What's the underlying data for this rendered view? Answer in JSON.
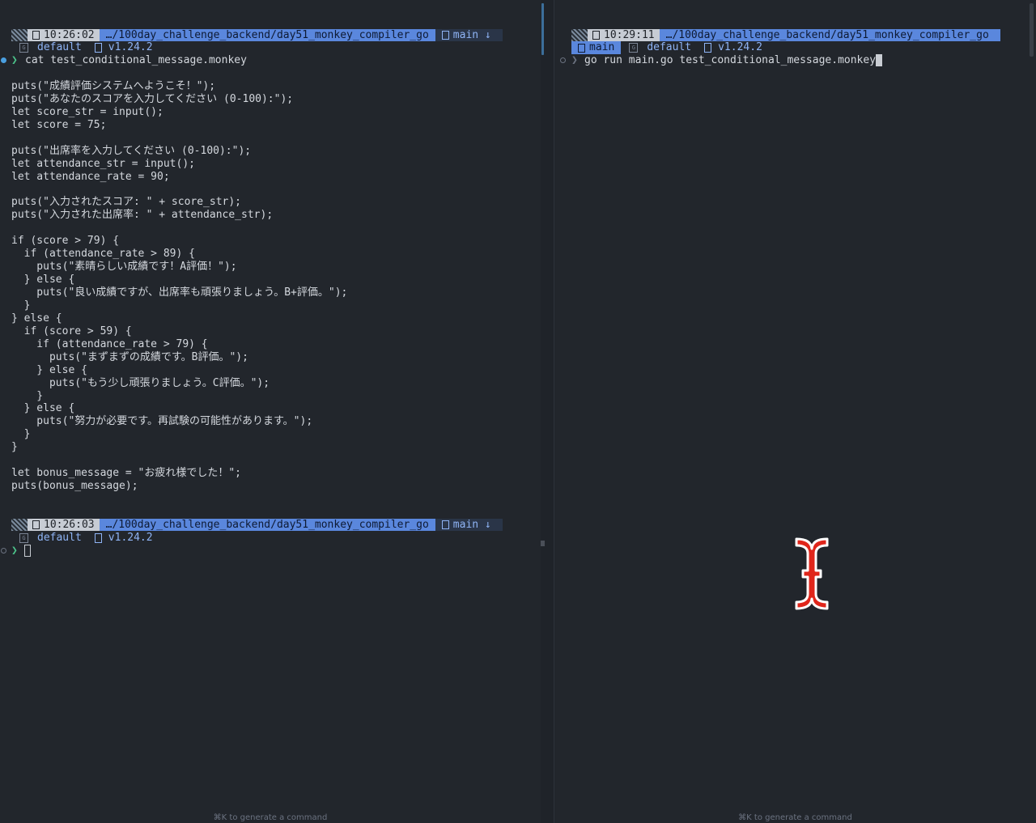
{
  "left_pane": {
    "prompt1": {
      "time": "10:26:02",
      "path": "…/100day_challenge_backend/day51_monkey_compiler_go",
      "branch": "main ↓",
      "context": "default",
      "go_version": "v1.24.2"
    },
    "command": "cat test_conditional_message.monkey",
    "file_lines": [
      "",
      "puts(\"成績評価システムへようこそ！\");",
      "puts(\"あなたのスコアを入力してください (0-100):\");",
      "let score_str = input();",
      "let score = 75;",
      "",
      "puts(\"出席率を入力してください (0-100):\");",
      "let attendance_str = input();",
      "let attendance_rate = 90;",
      "",
      "puts(\"入力されたスコア: \" + score_str);",
      "puts(\"入力された出席率: \" + attendance_str);",
      "",
      "if (score > 79) {",
      "  if (attendance_rate > 89) {",
      "    puts(\"素晴らしい成績です！A評価！\");",
      "  } else {",
      "    puts(\"良い成績ですが、出席率も頑張りましょう。B+評価。\");",
      "  }",
      "} else {",
      "  if (score > 59) {",
      "    if (attendance_rate > 79) {",
      "      puts(\"まずまずの成績です。B評価。\");",
      "    } else {",
      "      puts(\"もう少し頑張りましょう。C評価。\");",
      "    }",
      "  } else {",
      "    puts(\"努力が必要です。再試験の可能性があります。\");",
      "  }",
      "}",
      "",
      "let bonus_message = \"お疲れ様でした！\";",
      "puts(bonus_message);"
    ],
    "prompt2": {
      "time": "10:26:03",
      "path": "…/100day_challenge_backend/day51_monkey_compiler_go",
      "branch": "main ↓",
      "context": "default",
      "go_version": "v1.24.2"
    },
    "hint": "⌘K to generate a command"
  },
  "right_pane": {
    "prompt": {
      "time": "10:29:11",
      "path": "…/100day_challenge_backend/day51_monkey_compiler_go",
      "branch": "main",
      "context": "default",
      "go_version": "v1.24.2"
    },
    "command": "go run main.go test_conditional_message.monkey",
    "hint": "⌘K to generate a command"
  },
  "colors": {
    "background": "#22262c",
    "path_segment": "#5a87dd",
    "prompt_chevron": "#4cc38a",
    "status_dot": "#4a9fe0",
    "ibeam_cursor": "#e0261b"
  }
}
